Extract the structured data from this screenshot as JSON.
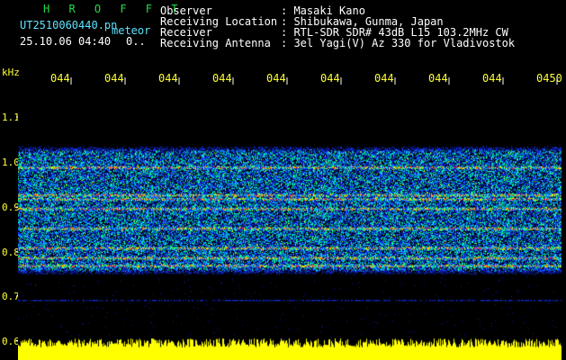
{
  "header": {
    "title": "H R O F F T",
    "filename": "UT2510060440.pn",
    "meteor_label": "meteor",
    "datetime": "25.10.06 04:40",
    "count": "0..",
    "observer_label": "Observer",
    "observer_value": ": Masaki Kano",
    "location_label": "Receiving Location",
    "location_value": ": Shibukawa, Gunma, Japan",
    "receiver_label": "Receiver",
    "receiver_value": ": RTL-SDR SDR# 43dB L15 103.2MHz CW",
    "antenna_label": "Receiving Antenna",
    "antenna_value": ": 3el Yagi(V) Az 330 for Vladivostok"
  },
  "axis": {
    "y_unit": "kHz",
    "y_ticks": [
      "1.1",
      "1.0",
      "0.9",
      "0.8",
      "0.7",
      "0.6"
    ],
    "x_ticks": [
      "044",
      "044",
      "044",
      "044",
      "044",
      "044",
      "044",
      "044",
      "044",
      "0450"
    ]
  },
  "colors": {
    "background": "#000000",
    "signal_bar": "#ffff00",
    "header_text": "#5fe3ff",
    "title_text": "#22dd44"
  }
}
